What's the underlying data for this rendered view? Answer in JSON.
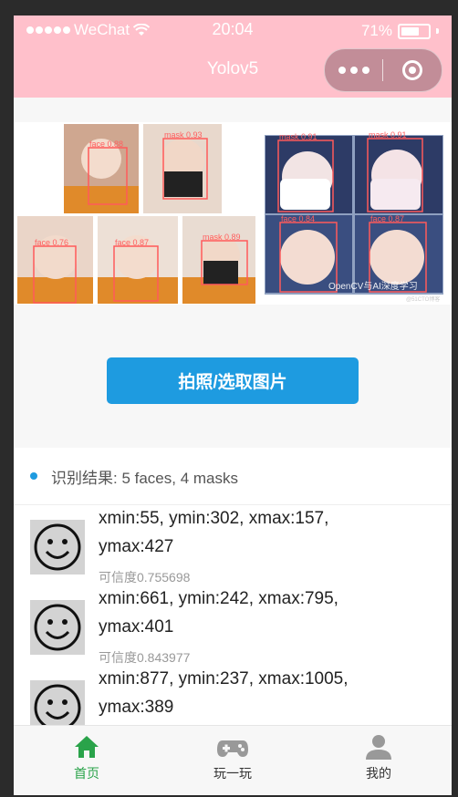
{
  "status_bar": {
    "carrier": "WeChat",
    "time": "20:04",
    "battery": "71%",
    "battery_level": 0.71
  },
  "navbar": {
    "title": "Yolov5"
  },
  "hero": {
    "labels": [
      "face 0.88",
      "mask 0.93",
      "face 0.76",
      "face 0.87",
      "mask 0.89",
      "mask 0.91",
      "mask 0.91",
      "face 0.84",
      "face 0.87"
    ],
    "watermark": "OpenCV与AI深度学习",
    "credit": "@51CTO博客"
  },
  "capture_button": {
    "label": "拍照/选取图片"
  },
  "results": {
    "header": "识别结果: 5 faces, 4 masks",
    "items": [
      {
        "coords": "xmin:55, ymin:302, xmax:157, ymax:427",
        "confidence": "可信度0.755698"
      },
      {
        "coords": "xmin:661, ymin:242, xmax:795, ymax:401",
        "confidence": "可信度0.843977"
      },
      {
        "coords": "xmin:877, ymin:237, xmax:1005, ymax:389",
        "confidence": ""
      }
    ]
  },
  "tabbar": {
    "tabs": [
      {
        "label": "首页",
        "icon": "home-icon",
        "active": true
      },
      {
        "label": "玩一玩",
        "icon": "gamepad-icon",
        "active": false
      },
      {
        "label": "我的",
        "icon": "user-icon",
        "active": false
      }
    ]
  },
  "colors": {
    "pink": "#ffc0cb",
    "blue": "#1e9be0",
    "green": "#2aa34a"
  }
}
